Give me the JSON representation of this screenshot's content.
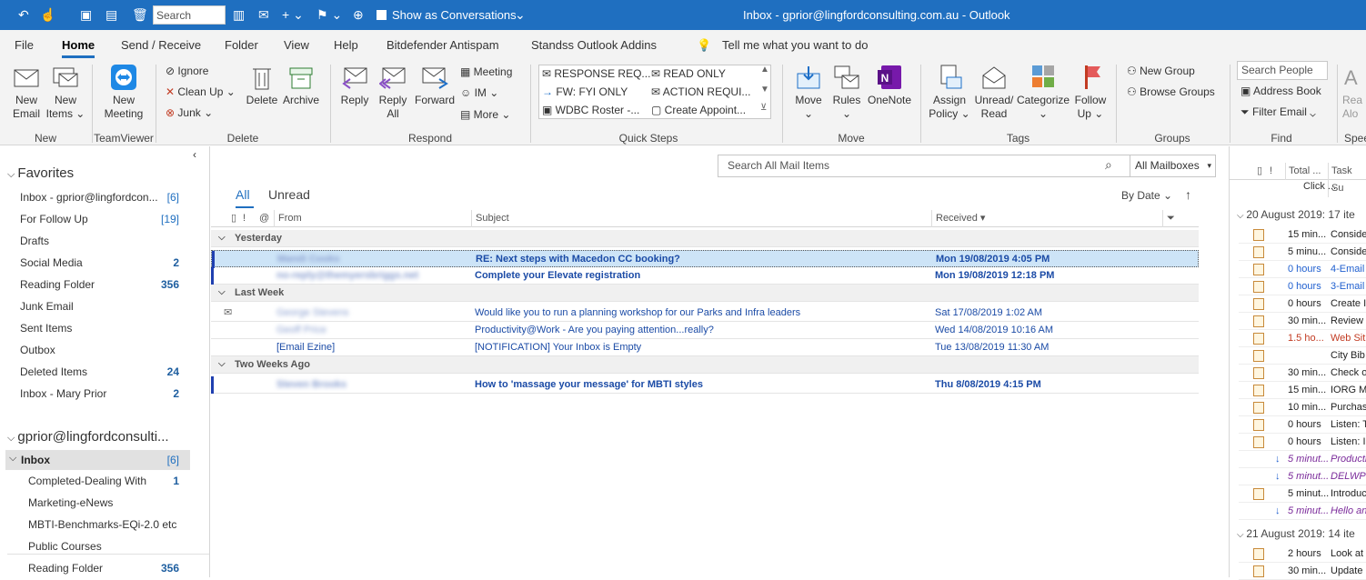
{
  "titlebar": {
    "search_placeholder": "Search People",
    "conversations_label": "Show as Conversations",
    "window_title": "Inbox - gprior@lingfordconsulting.com.au - Outlook"
  },
  "menu": {
    "tabs": [
      "File",
      "Home",
      "Send / Receive",
      "Folder",
      "View",
      "Help",
      "Bitdefender Antispam",
      "Standss Outlook Addins"
    ],
    "tell_me": "Tell me what you want to do"
  },
  "ribbon": {
    "new": {
      "new_email": "New\nEmail",
      "new_items": "New\nItems ⌄",
      "group": "New"
    },
    "teamviewer": {
      "new_meeting": "New\nMeeting",
      "group": "TeamViewer"
    },
    "delete": {
      "ignore": "Ignore",
      "clean_up": "Clean Up ⌄",
      "junk": "Junk ⌄",
      "delete": "Delete",
      "archive": "Archive",
      "group": "Delete"
    },
    "respond": {
      "reply": "Reply",
      "reply_all": "Reply\nAll",
      "forward": "Forward",
      "meeting": "Meeting",
      "im": "IM ⌄",
      "more": "More ⌄",
      "group": "Respond"
    },
    "quick_steps": {
      "items": [
        "RESPONSE REQ...",
        "READ ONLY",
        "FW: FYI ONLY",
        "ACTION REQUI...",
        "WDBC Roster -...",
        "Create Appoint..."
      ],
      "group": "Quick Steps"
    },
    "move": {
      "move": "Move\n⌄",
      "rules": "Rules\n⌄",
      "onenote": "OneNote",
      "group": "Move"
    },
    "tags": {
      "assign_policy": "Assign\nPolicy ⌄",
      "unread_read": "Unread/\nRead",
      "categorize": "Categorize\n⌄",
      "follow_up": "Follow\nUp ⌄",
      "group": "Tags"
    },
    "groups": {
      "new_group": "New Group",
      "browse_groups": "Browse Groups",
      "group": "Groups"
    },
    "find": {
      "search_people": "Search People",
      "address_book": "Address Book",
      "filter_email": "Filter Email ⌄",
      "group": "Find"
    },
    "speech": {
      "read": "Rea\nAlo",
      "group": "Spee"
    }
  },
  "nav": {
    "favorites_header": "Favorites",
    "favorites": [
      {
        "label": "Inbox - gprior@lingfordcon...",
        "count": "[6]"
      },
      {
        "label": "For Follow Up",
        "count": "[19]"
      },
      {
        "label": "Drafts",
        "count": ""
      },
      {
        "label": "Social Media",
        "count": "2"
      },
      {
        "label": "Reading Folder",
        "count": "356"
      },
      {
        "label": "Junk Email",
        "count": ""
      },
      {
        "label": "Sent Items",
        "count": ""
      },
      {
        "label": "Outbox",
        "count": ""
      },
      {
        "label": "Deleted Items",
        "count": "24"
      },
      {
        "label": "Inbox - Mary Prior",
        "count": "2"
      }
    ],
    "account_header": "gprior@lingfordconsulti...",
    "inbox": {
      "label": "Inbox",
      "count": "[6]"
    },
    "subfolders": [
      {
        "label": "Completed-Dealing With",
        "count": "1"
      },
      {
        "label": "Marketing-eNews",
        "count": ""
      },
      {
        "label": "MBTI-Benchmarks-EQi-2.0 etc",
        "count": ""
      },
      {
        "label": "Public Courses",
        "count": ""
      },
      {
        "label": "Reading Folder",
        "count": "356"
      }
    ]
  },
  "messages": {
    "search_placeholder": "Search All Mail Items",
    "mailbox_scope": "All Mailboxes",
    "filter_all": "All",
    "filter_unread": "Unread",
    "sort": "By Date",
    "columns": {
      "from": "From",
      "subject": "Subject",
      "received": "Received"
    },
    "groups": [
      {
        "label": "Yesterday",
        "rows": [
          {
            "from": "Mandi Cooks",
            "subject": "RE: Next steps with Macedon CC booking?",
            "received": "Mon 19/08/2019 4:05 PM",
            "selected": true,
            "unread": true
          },
          {
            "from": "no-reply@themyersbriggs.net",
            "subject": "Complete your Elevate registration",
            "received": "Mon 19/08/2019 12:18 PM",
            "unread": true
          }
        ]
      },
      {
        "label": "Last Week",
        "rows": [
          {
            "from": "George Stevens",
            "subject": "Would like you to run a planning workshop for our Parks and Infra leaders",
            "received": "Sat 17/08/2019 1:02 AM"
          },
          {
            "from": "Geoff Price",
            "subject": "Productivity@Work - Are you paying attention...really?",
            "received": "Wed 14/08/2019 10:16 AM"
          },
          {
            "from": "[Email Ezine]",
            "subject": "[NOTIFICATION] Your Inbox is Empty",
            "received": "Tue 13/08/2019 11:30 AM"
          }
        ]
      },
      {
        "label": "Two Weeks Ago",
        "rows": [
          {
            "from": "Steven Brooks",
            "subject": "How to 'massage your message' for MBTI styles",
            "received": "Thu 8/08/2019 4:15 PM",
            "unread": true
          }
        ]
      }
    ]
  },
  "tasks": {
    "col_total": "Total ...",
    "col_task": "Task Su",
    "click_text": "Click ...",
    "group1": "20 August 2019: 17 ite",
    "rows1": [
      {
        "d": "15 min...",
        "t": "Conside",
        "c": ""
      },
      {
        "d": "5 minu...",
        "t": "Conside",
        "c": ""
      },
      {
        "d": "0 hours",
        "t": "4-Email",
        "c": "blue"
      },
      {
        "d": "0 hours",
        "t": "3-Email",
        "c": "blue"
      },
      {
        "d": "0 hours",
        "t": "Create I",
        "c": ""
      },
      {
        "d": "30 min...",
        "t": "Review ...",
        "c": ""
      },
      {
        "d": "1.5 ho...",
        "t": "Web Sit",
        "c": "red"
      },
      {
        "d": "",
        "t": "City Bib",
        "c": ""
      },
      {
        "d": "30 min...",
        "t": "Check o",
        "c": ""
      },
      {
        "d": "15 min...",
        "t": "IORG M",
        "c": ""
      },
      {
        "d": "10 min...",
        "t": "Purchas",
        "c": ""
      },
      {
        "d": "0 hours",
        "t": "Listen: T",
        "c": ""
      },
      {
        "d": "0 hours",
        "t": "Listen: I",
        "c": ""
      },
      {
        "d": "5 minut...",
        "t": "Producti",
        "c": "purple"
      },
      {
        "d": "5 minut...",
        "t": "DELWP c",
        "c": "purple"
      },
      {
        "d": "5 minut...",
        "t": "Introduc",
        "c": ""
      },
      {
        "d": "5 minut...",
        "t": "Hello an",
        "c": "purple"
      }
    ],
    "group2": "21 August 2019: 14 ite",
    "rows2": [
      {
        "d": "2 hours",
        "t": "Look at",
        "c": ""
      },
      {
        "d": "30 min...",
        "t": "Update",
        "c": ""
      }
    ]
  }
}
